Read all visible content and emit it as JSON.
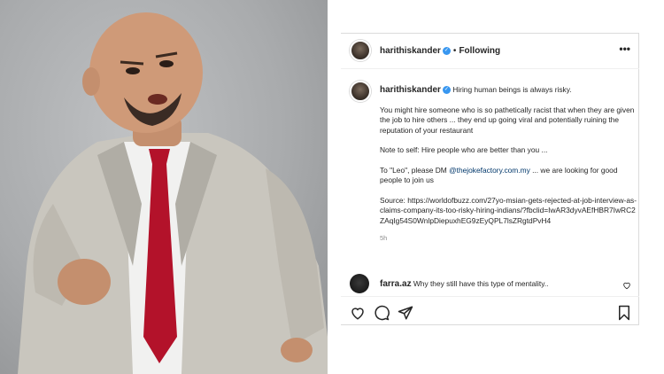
{
  "header": {
    "username": "harithiskander",
    "follow_status": "Following",
    "separator": "•",
    "more_icon": "more-options-icon"
  },
  "caption": {
    "username": "harithiskander",
    "lead": "Hiring human beings is always risky.",
    "p1": "You might hire someone who is so pathetically racist that when they are given the job to hire others ... they end up going viral and potentially ruining the reputation of your restaurant",
    "p2": "Note to self: Hire people who are better than you ...",
    "p3_before": "To \"Leo\", please DM ",
    "p3_tag": "@thejokefactory.com.my",
    "p3_after": " ... we are looking for good people to join us",
    "p4": "Source: https://worldofbuzz.com/27yo-msian-gets-rejected-at-job-interview-as-claims-company-its-too-risky-hiring-indians/?fbclid=IwAR3dyvAEfHBR7IwRC2ZAqIg54S0WnlpDiepuxhEG9zEyQPL7lsZRgtdPvH4",
    "time": "5h"
  },
  "comment": {
    "username": "farra.az",
    "text": "Why they still have this type of mentality.."
  },
  "actions": {
    "icons": [
      "heart-icon",
      "comment-icon",
      "share-icon",
      "bookmark-icon"
    ]
  },
  "colors": {
    "verified": "#3897f0",
    "mention": "#00376b",
    "muted": "#8e8e8e",
    "tie": "#b3122a",
    "suit": "#c9c6be"
  }
}
